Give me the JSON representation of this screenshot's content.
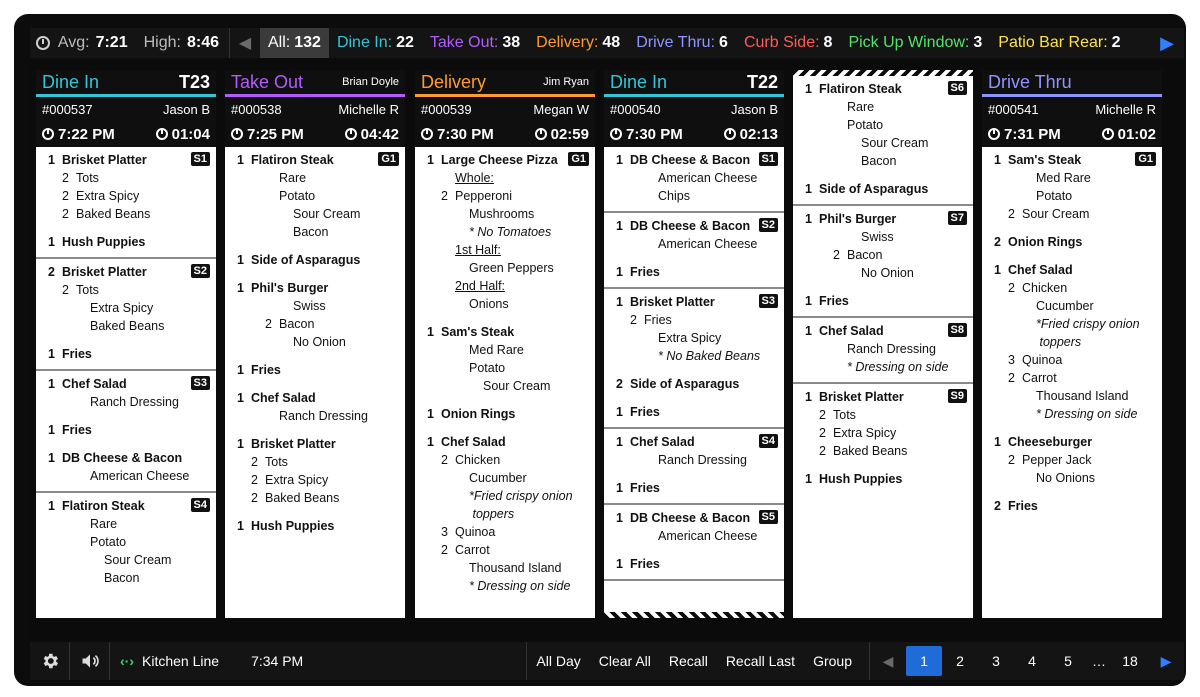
{
  "topbar": {
    "avg_label": "Avg:",
    "avg_value": "7:21",
    "high_label": "High:",
    "high_value": "8:46",
    "filters": [
      {
        "label": "All:",
        "count": "132",
        "color": "#ffffff"
      },
      {
        "label": "Dine In:",
        "count": "22",
        "color": "#33c6d6"
      },
      {
        "label": "Take Out:",
        "count": "38",
        "color": "#b25bff"
      },
      {
        "label": "Delivery:",
        "count": "48",
        "color": "#ff9a2e"
      },
      {
        "label": "Drive Thru:",
        "count": "6",
        "color": "#8e95ff"
      },
      {
        "label": "Curb Side:",
        "count": "8",
        "color": "#ff5a5a"
      },
      {
        "label": "Pick Up Window:",
        "count": "3",
        "color": "#55e26a"
      },
      {
        "label": "Patio Bar Rear:",
        "count": "2",
        "color": "#ffe14a"
      }
    ]
  },
  "orders": [
    {
      "type": "Dine In",
      "type_color": "#33c6d6",
      "right": "T23",
      "right_style": "table",
      "number": "#000537",
      "server": "Jason B",
      "time": "7:22 PM",
      "elapsed": "01:04",
      "seats": [
        {
          "badge": "S1",
          "lines": [
            {
              "t": "1",
              "text": "Brisket Platter",
              "lvl": 0
            },
            {
              "t": "2",
              "text": "Tots",
              "lvl": 1
            },
            {
              "t": "2",
              "text": "Extra Spicy",
              "lvl": 1
            },
            {
              "t": "2",
              "text": "Baked Beans",
              "lvl": 1
            },
            {
              "t": "1",
              "text": "Hush Puppies",
              "lvl": 0,
              "gap": true
            }
          ]
        },
        {
          "badge": "S2",
          "lines": [
            {
              "t": "2",
              "text": "Brisket Platter",
              "lvl": 0
            },
            {
              "t": "2",
              "text": "Tots",
              "lvl": 1
            },
            {
              "t": "",
              "text": "Extra Spicy",
              "lvl": 2
            },
            {
              "t": "",
              "text": "Baked Beans",
              "lvl": 2
            },
            {
              "t": "1",
              "text": "Fries",
              "lvl": 0,
              "gap": true
            }
          ]
        },
        {
          "badge": "S3",
          "lines": [
            {
              "t": "1",
              "text": "Chef Salad",
              "lvl": 0
            },
            {
              "t": "",
              "text": "Ranch Dressing",
              "lvl": 2
            },
            {
              "t": "1",
              "text": "Fries",
              "lvl": 0,
              "gap": true
            },
            {
              "t": "1",
              "text": "DB Cheese & Bacon",
              "lvl": 0,
              "gap": true
            },
            {
              "t": "",
              "text": "American Cheese",
              "lvl": 2
            }
          ]
        },
        {
          "badge": "S4",
          "lines": [
            {
              "t": "1",
              "text": "Flatiron Steak",
              "lvl": 0
            },
            {
              "t": "",
              "text": "Rare",
              "lvl": 2
            },
            {
              "t": "",
              "text": "Potato",
              "lvl": 2
            },
            {
              "t": "",
              "text": "Sour Cream",
              "lvl": 3
            },
            {
              "t": "",
              "text": "Bacon",
              "lvl": 3
            }
          ]
        }
      ]
    },
    {
      "type": "Take Out",
      "type_color": "#b25bff",
      "right": "Brian Doyle",
      "right_style": "name",
      "number": "#000538",
      "server": "Michelle R",
      "time": "7:25 PM",
      "elapsed": "04:42",
      "seats": [
        {
          "badge": "G1",
          "lines": [
            {
              "t": "1",
              "text": "Flatiron Steak",
              "lvl": 0
            },
            {
              "t": "",
              "text": "Rare",
              "lvl": 2
            },
            {
              "t": "",
              "text": "Potato",
              "lvl": 2
            },
            {
              "t": "",
              "text": "Sour Cream",
              "lvl": 3
            },
            {
              "t": "",
              "text": "Bacon",
              "lvl": 3
            },
            {
              "t": "1",
              "text": "Side of Asparagus",
              "lvl": 0,
              "gap": true
            },
            {
              "t": "1",
              "text": "Phil's Burger",
              "lvl": 0,
              "gap": true
            },
            {
              "t": "",
              "text": "Swiss",
              "lvl": 3
            },
            {
              "t": "2",
              "text": "Bacon",
              "lvl": 2
            },
            {
              "t": "",
              "text": "No Onion",
              "lvl": 3
            },
            {
              "t": "1",
              "text": "Fries",
              "lvl": 0,
              "gap": true
            },
            {
              "t": "1",
              "text": "Chef Salad",
              "lvl": 0,
              "gap": true
            },
            {
              "t": "",
              "text": "Ranch Dressing",
              "lvl": 2
            },
            {
              "t": "1",
              "text": "Brisket Platter",
              "lvl": 0,
              "gap": true
            },
            {
              "t": "2",
              "text": "Tots",
              "lvl": 1
            },
            {
              "t": "2",
              "text": "Extra Spicy",
              "lvl": 1
            },
            {
              "t": "2",
              "text": "Baked Beans",
              "lvl": 1
            },
            {
              "t": "1",
              "text": "Hush Puppies",
              "lvl": 0,
              "gap": true
            }
          ]
        }
      ]
    },
    {
      "type": "Delivery",
      "type_color": "#ff9a2e",
      "right": "Jim Ryan",
      "right_style": "name",
      "number": "#000539",
      "server": "Megan W",
      "time": "7:30 PM",
      "elapsed": "02:59",
      "seats": [
        {
          "badge": "G1",
          "lines": [
            {
              "t": "1",
              "text": "Large Cheese Pizza",
              "lvl": 0
            },
            {
              "t": "",
              "text": "Whole:",
              "lvl": 1,
              "und": true
            },
            {
              "t": "2",
              "text": "Pepperoni",
              "lvl": 1
            },
            {
              "t": "",
              "text": "Mushrooms",
              "lvl": 2
            },
            {
              "t": "",
              "text": "* No Tomatoes",
              "lvl": 2,
              "ital": true
            },
            {
              "t": "",
              "text": "1st Half:",
              "lvl": 1,
              "und": true
            },
            {
              "t": "",
              "text": "Green Peppers",
              "lvl": 2
            },
            {
              "t": "",
              "text": "2nd Half:",
              "lvl": 1,
              "und": true
            },
            {
              "t": "",
              "text": "Onions",
              "lvl": 2
            },
            {
              "t": "1",
              "text": "Sam's Steak",
              "lvl": 0,
              "gap": true
            },
            {
              "t": "",
              "text": "Med Rare",
              "lvl": 2
            },
            {
              "t": "",
              "text": "Potato",
              "lvl": 2
            },
            {
              "t": "",
              "text": "Sour Cream",
              "lvl": 3
            },
            {
              "t": "1",
              "text": "Onion Rings",
              "lvl": 0,
              "gap": true
            },
            {
              "t": "1",
              "text": "Chef Salad",
              "lvl": 0,
              "gap": true
            },
            {
              "t": "2",
              "text": "Chicken",
              "lvl": 1
            },
            {
              "t": "",
              "text": "Cucumber",
              "lvl": 2
            },
            {
              "t": "",
              "text": "*Fried crispy onion",
              "lvl": 2,
              "ital": true
            },
            {
              "t": "",
              "text": " toppers",
              "lvl": 2,
              "ital": true
            },
            {
              "t": "3",
              "text": "Quinoa",
              "lvl": 1
            },
            {
              "t": "2",
              "text": "Carrot",
              "lvl": 1
            },
            {
              "t": "",
              "text": "Thousand Island",
              "lvl": 2
            },
            {
              "t": "",
              "text": "* Dressing on side",
              "lvl": 2,
              "ital": true
            }
          ]
        }
      ]
    },
    {
      "type": "Dine In",
      "type_color": "#33c6d6",
      "right": "T22",
      "right_style": "table",
      "number": "#000540",
      "server": "Jason B",
      "time": "7:30 PM",
      "elapsed": "02:13",
      "torn_bottom": true,
      "seats": [
        {
          "badge": "S1",
          "lines": [
            {
              "t": "1",
              "text": "DB Cheese & Bacon",
              "lvl": 0
            },
            {
              "t": "",
              "text": "American Cheese",
              "lvl": 2
            },
            {
              "t": "",
              "text": "Chips",
              "lvl": 2
            }
          ]
        },
        {
          "badge": "S2",
          "lines": [
            {
              "t": "1",
              "text": "DB Cheese & Bacon",
              "lvl": 0
            },
            {
              "t": "",
              "text": "American Cheese",
              "lvl": 2
            },
            {
              "t": "1",
              "text": "Fries",
              "lvl": 0,
              "gap": true
            }
          ]
        },
        {
          "badge": "S3",
          "lines": [
            {
              "t": "1",
              "text": "Brisket Platter",
              "lvl": 0
            },
            {
              "t": "2",
              "text": "Fries",
              "lvl": 1
            },
            {
              "t": "",
              "text": "Extra Spicy",
              "lvl": 2
            },
            {
              "t": "",
              "text": "* No Baked Beans",
              "lvl": 2,
              "ital": true
            },
            {
              "t": "2",
              "text": "Side of Asparagus",
              "lvl": 0,
              "gap": true
            },
            {
              "t": "1",
              "text": "Fries",
              "lvl": 0,
              "gap": true
            }
          ]
        },
        {
          "badge": "S4",
          "lines": [
            {
              "t": "1",
              "text": "Chef Salad",
              "lvl": 0
            },
            {
              "t": "",
              "text": "Ranch Dressing",
              "lvl": 2
            },
            {
              "t": "1",
              "text": "Fries",
              "lvl": 0,
              "gap": true
            }
          ]
        },
        {
          "badge": "S5",
          "lines": [
            {
              "t": "1",
              "text": "DB Cheese & Bacon",
              "lvl": 0
            },
            {
              "t": "",
              "text": "American Cheese",
              "lvl": 2
            },
            {
              "t": "1",
              "text": "Fries",
              "lvl": 0,
              "gap": true
            }
          ]
        }
      ]
    },
    {
      "type": "",
      "continued": true,
      "seats": [
        {
          "badge": "S6",
          "lines": [
            {
              "t": "1",
              "text": "Flatiron Steak",
              "lvl": 0
            },
            {
              "t": "",
              "text": "Rare",
              "lvl": 2
            },
            {
              "t": "",
              "text": "Potato",
              "lvl": 2
            },
            {
              "t": "",
              "text": "Sour Cream",
              "lvl": 3
            },
            {
              "t": "",
              "text": "Bacon",
              "lvl": 3
            },
            {
              "t": "1",
              "text": "Side of Asparagus",
              "lvl": 0,
              "gap": true
            }
          ]
        },
        {
          "badge": "S7",
          "lines": [
            {
              "t": "1",
              "text": "Phil's Burger",
              "lvl": 0
            },
            {
              "t": "",
              "text": "Swiss",
              "lvl": 3
            },
            {
              "t": "2",
              "text": "Bacon",
              "lvl": 2
            },
            {
              "t": "",
              "text": "No Onion",
              "lvl": 3
            },
            {
              "t": "1",
              "text": "Fries",
              "lvl": 0,
              "gap": true
            }
          ]
        },
        {
          "badge": "S8",
          "lines": [
            {
              "t": "1",
              "text": "Chef Salad",
              "lvl": 0
            },
            {
              "t": "",
              "text": "Ranch Dressing",
              "lvl": 2
            },
            {
              "t": "",
              "text": "* Dressing on side",
              "lvl": 2,
              "ital": true
            }
          ]
        },
        {
          "badge": "S9",
          "lines": [
            {
              "t": "1",
              "text": "Brisket Platter",
              "lvl": 0
            },
            {
              "t": "2",
              "text": "Tots",
              "lvl": 1
            },
            {
              "t": "2",
              "text": "Extra Spicy",
              "lvl": 1
            },
            {
              "t": "2",
              "text": "Baked Beans",
              "lvl": 1
            },
            {
              "t": "1",
              "text": "Hush Puppies",
              "lvl": 0,
              "gap": true
            }
          ]
        }
      ]
    },
    {
      "type": "Drive Thru",
      "type_color": "#8e95ff",
      "right": "",
      "right_style": "none",
      "number": "#000541",
      "server": "Michelle R",
      "time": "7:31 PM",
      "elapsed": "01:02",
      "seats": [
        {
          "badge": "G1",
          "lines": [
            {
              "t": "1",
              "text": "Sam's Steak",
              "lvl": 0
            },
            {
              "t": "",
              "text": "Med Rare",
              "lvl": 2
            },
            {
              "t": "",
              "text": "Potato",
              "lvl": 2
            },
            {
              "t": "2",
              "text": "Sour Cream",
              "lvl": 1
            },
            {
              "t": "2",
              "text": "Onion Rings",
              "lvl": 0,
              "gap": true
            },
            {
              "t": "1",
              "text": "Chef Salad",
              "lvl": 0,
              "gap": true
            },
            {
              "t": "2",
              "text": "Chicken",
              "lvl": 1
            },
            {
              "t": "",
              "text": "Cucumber",
              "lvl": 2
            },
            {
              "t": "",
              "text": "*Fried crispy onion",
              "lvl": 2,
              "ital": true
            },
            {
              "t": "",
              "text": " toppers",
              "lvl": 2,
              "ital": true
            },
            {
              "t": "3",
              "text": "Quinoa",
              "lvl": 1
            },
            {
              "t": "2",
              "text": "Carrot",
              "lvl": 1
            },
            {
              "t": "",
              "text": "Thousand Island",
              "lvl": 2
            },
            {
              "t": "",
              "text": "* Dressing on side",
              "lvl": 2,
              "ital": true
            },
            {
              "t": "1",
              "text": "Cheeseburger",
              "lvl": 0,
              "gap": true
            },
            {
              "t": "2",
              "text": "Pepper Jack",
              "lvl": 1
            },
            {
              "t": "",
              "text": "No Onions",
              "lvl": 2
            },
            {
              "t": "2",
              "text": "Fries",
              "lvl": 0,
              "gap": true
            }
          ]
        }
      ]
    }
  ],
  "bottombar": {
    "station": "Kitchen Line",
    "time": "7:34 PM",
    "actions": [
      "All Day",
      "Clear All",
      "Recall",
      "Recall Last",
      "Group"
    ],
    "pages": [
      "1",
      "2",
      "3",
      "4",
      "5",
      "…",
      "18"
    ],
    "active_page": "1"
  }
}
